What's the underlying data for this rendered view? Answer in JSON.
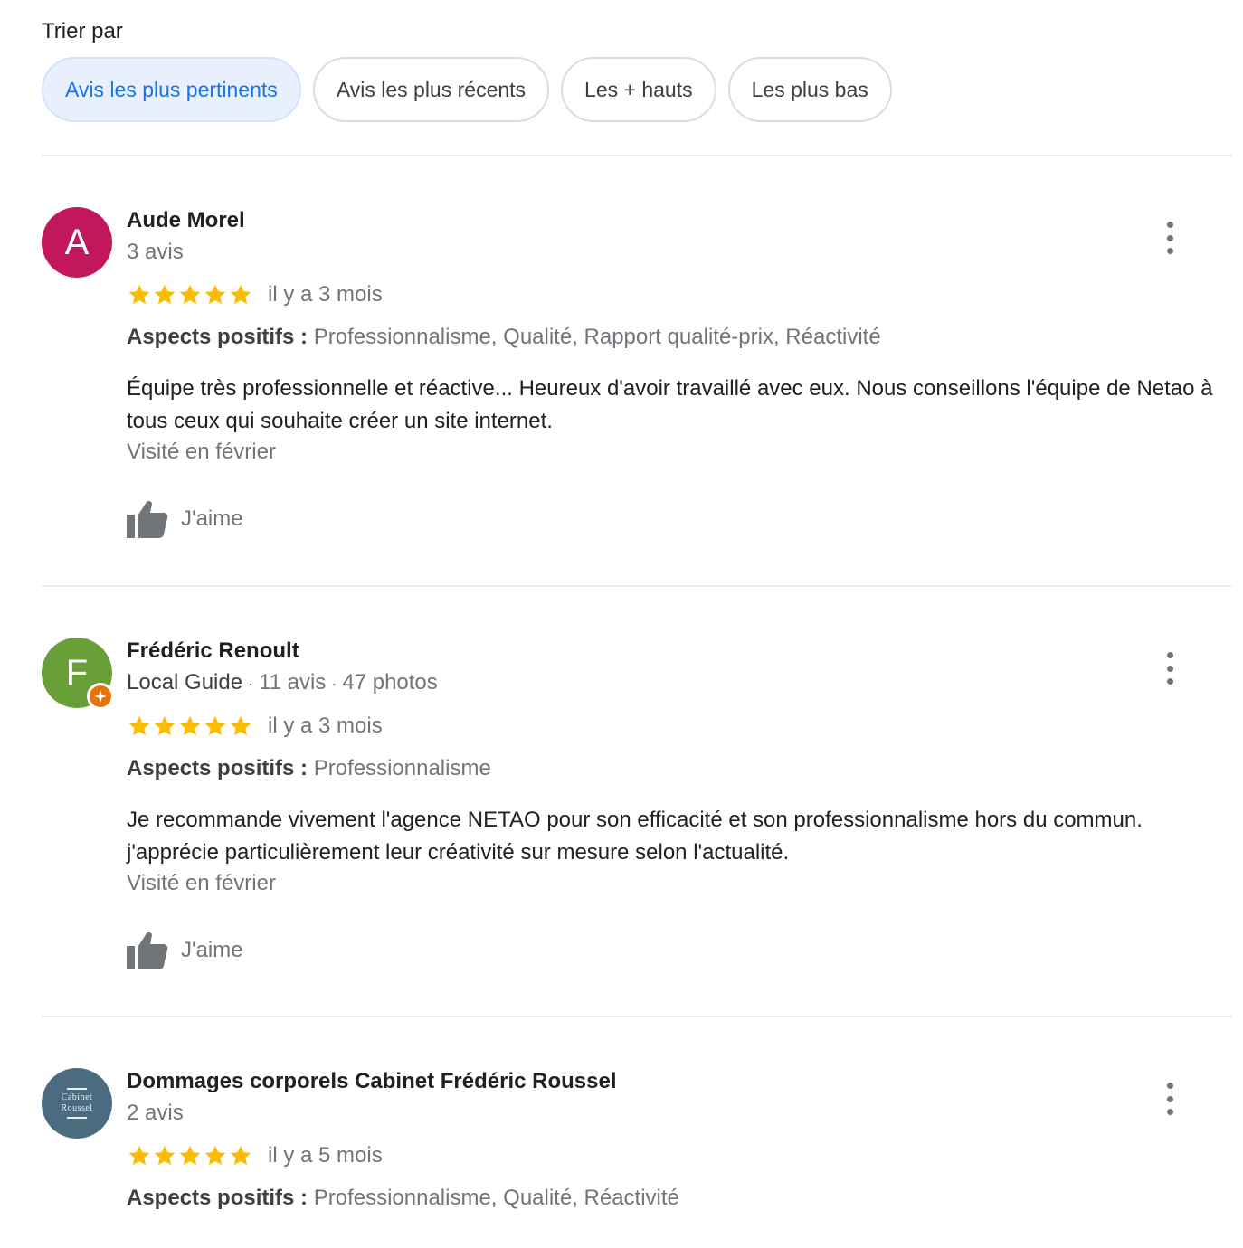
{
  "sort": {
    "label": "Trier par",
    "options": [
      {
        "label": "Avis les plus pertinents",
        "active": true
      },
      {
        "label": "Avis les plus récents",
        "active": false
      },
      {
        "label": "Les + hauts",
        "active": false
      },
      {
        "label": "Les plus bas",
        "active": false
      }
    ]
  },
  "colors": {
    "star": "#fbbc04",
    "active_chip_bg": "#e8f0fe",
    "active_chip_text": "#1a73e8"
  },
  "reviews": [
    {
      "avatar_letter": "A",
      "avatar_color": "#c2185b",
      "name": "Aude Morel",
      "count": "3 avis",
      "rating": 5,
      "time": "il y a 3 mois",
      "aspects_label": "Aspects positifs :",
      "aspects": "Professionnalisme, Qualité, Rapport qualité-prix, Réactivité",
      "text": "Équipe très professionnelle et réactive... Heureux d'avoir travaillé avec eux. Nous conseillons l'équipe de Netao à tous ceux qui souhaite créer un site internet.",
      "visited": "Visité en février",
      "like_label": "J'aime",
      "icons": {
        "like": "thumbs-up-icon",
        "more": "more-vert-icon"
      }
    },
    {
      "avatar_letter": "F",
      "avatar_color": "#689f38",
      "local_guide_badge": true,
      "name": "Frédéric Renoult",
      "guide": "Local Guide",
      "count": "11 avis",
      "photos": "47 photos",
      "rating": 5,
      "time": "il y a 3 mois",
      "aspects_label": "Aspects positifs :",
      "aspects": "Professionnalisme",
      "text": "Je recommande vivement l'agence NETAO pour son efficacité et son professionnalisme hors du commun. j'apprécie particulièrement leur créativité sur mesure selon l'actualité.",
      "visited": "Visité en février",
      "like_label": "J'aime",
      "icons": {
        "like": "thumbs-up-icon",
        "more": "more-vert-icon",
        "badge": "local-guide-badge-icon"
      }
    },
    {
      "avatar_color": "#4a6b80",
      "avatar_logo_lines": [
        "Cabinet",
        "Roussel"
      ],
      "name": "Dommages corporels Cabinet Frédéric Roussel",
      "count": "2 avis",
      "rating": 5,
      "time": "il y a 5 mois",
      "aspects_label": "Aspects positifs :",
      "aspects": "Professionnalisme, Qualité, Réactivité",
      "icons": {
        "more": "more-vert-icon"
      }
    }
  ]
}
